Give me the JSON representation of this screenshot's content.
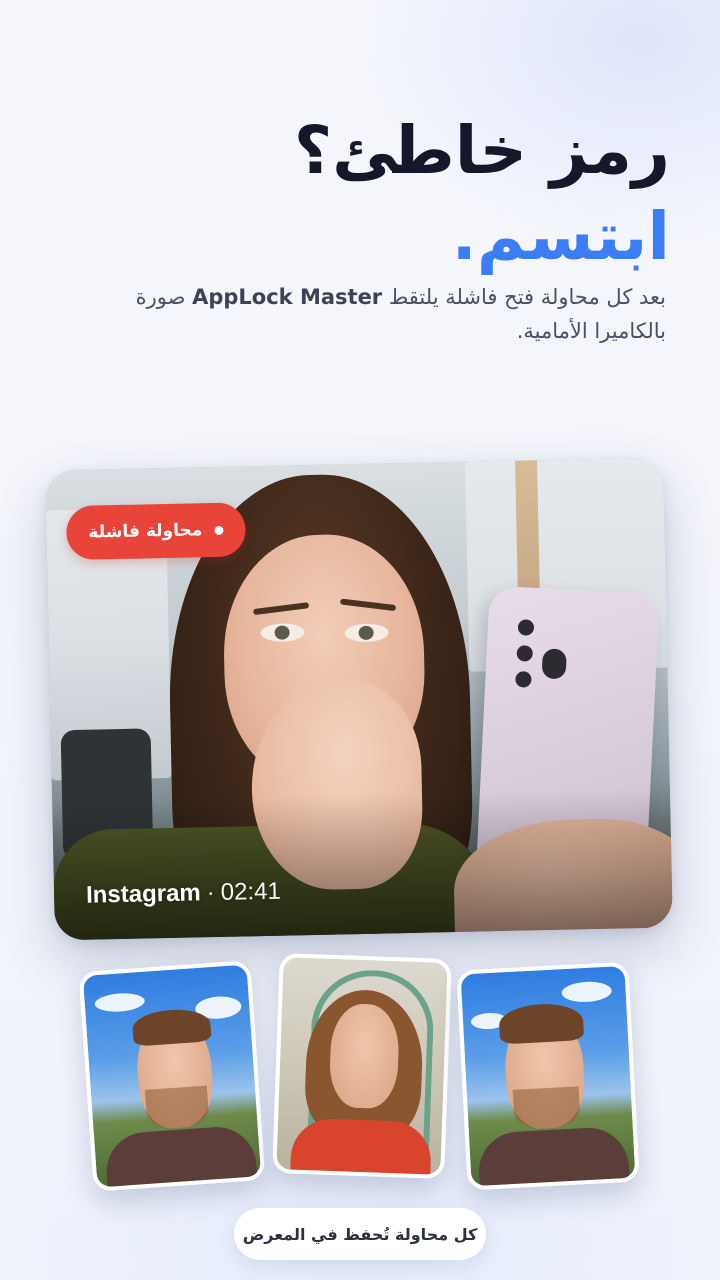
{
  "headline": {
    "line1": "رمز خاطئ؟",
    "line2": "ابتسم."
  },
  "subtitle": {
    "before_brand": "بعد كل محاولة فتح فاشلة يلتقط ",
    "brand": "AppLock Master",
    "after_brand": " صورة بالكاميرا الأمامية."
  },
  "main_photo": {
    "badge_label": "محاولة فاشلة",
    "app_name": "Instagram",
    "separator": "·",
    "time": "02:41"
  },
  "thumbnails": [
    {
      "name": "thumb-man-outdoor-left"
    },
    {
      "name": "thumb-woman-indoor"
    },
    {
      "name": "thumb-man-outdoor-right"
    }
  ],
  "footer": {
    "gallery_note": "كل محاولة تُحفظ في المعرض"
  },
  "colors": {
    "accent": "#3b7ef4",
    "headline": "#15182a",
    "badge": "#e8443a",
    "text_muted": "#4a5066"
  }
}
